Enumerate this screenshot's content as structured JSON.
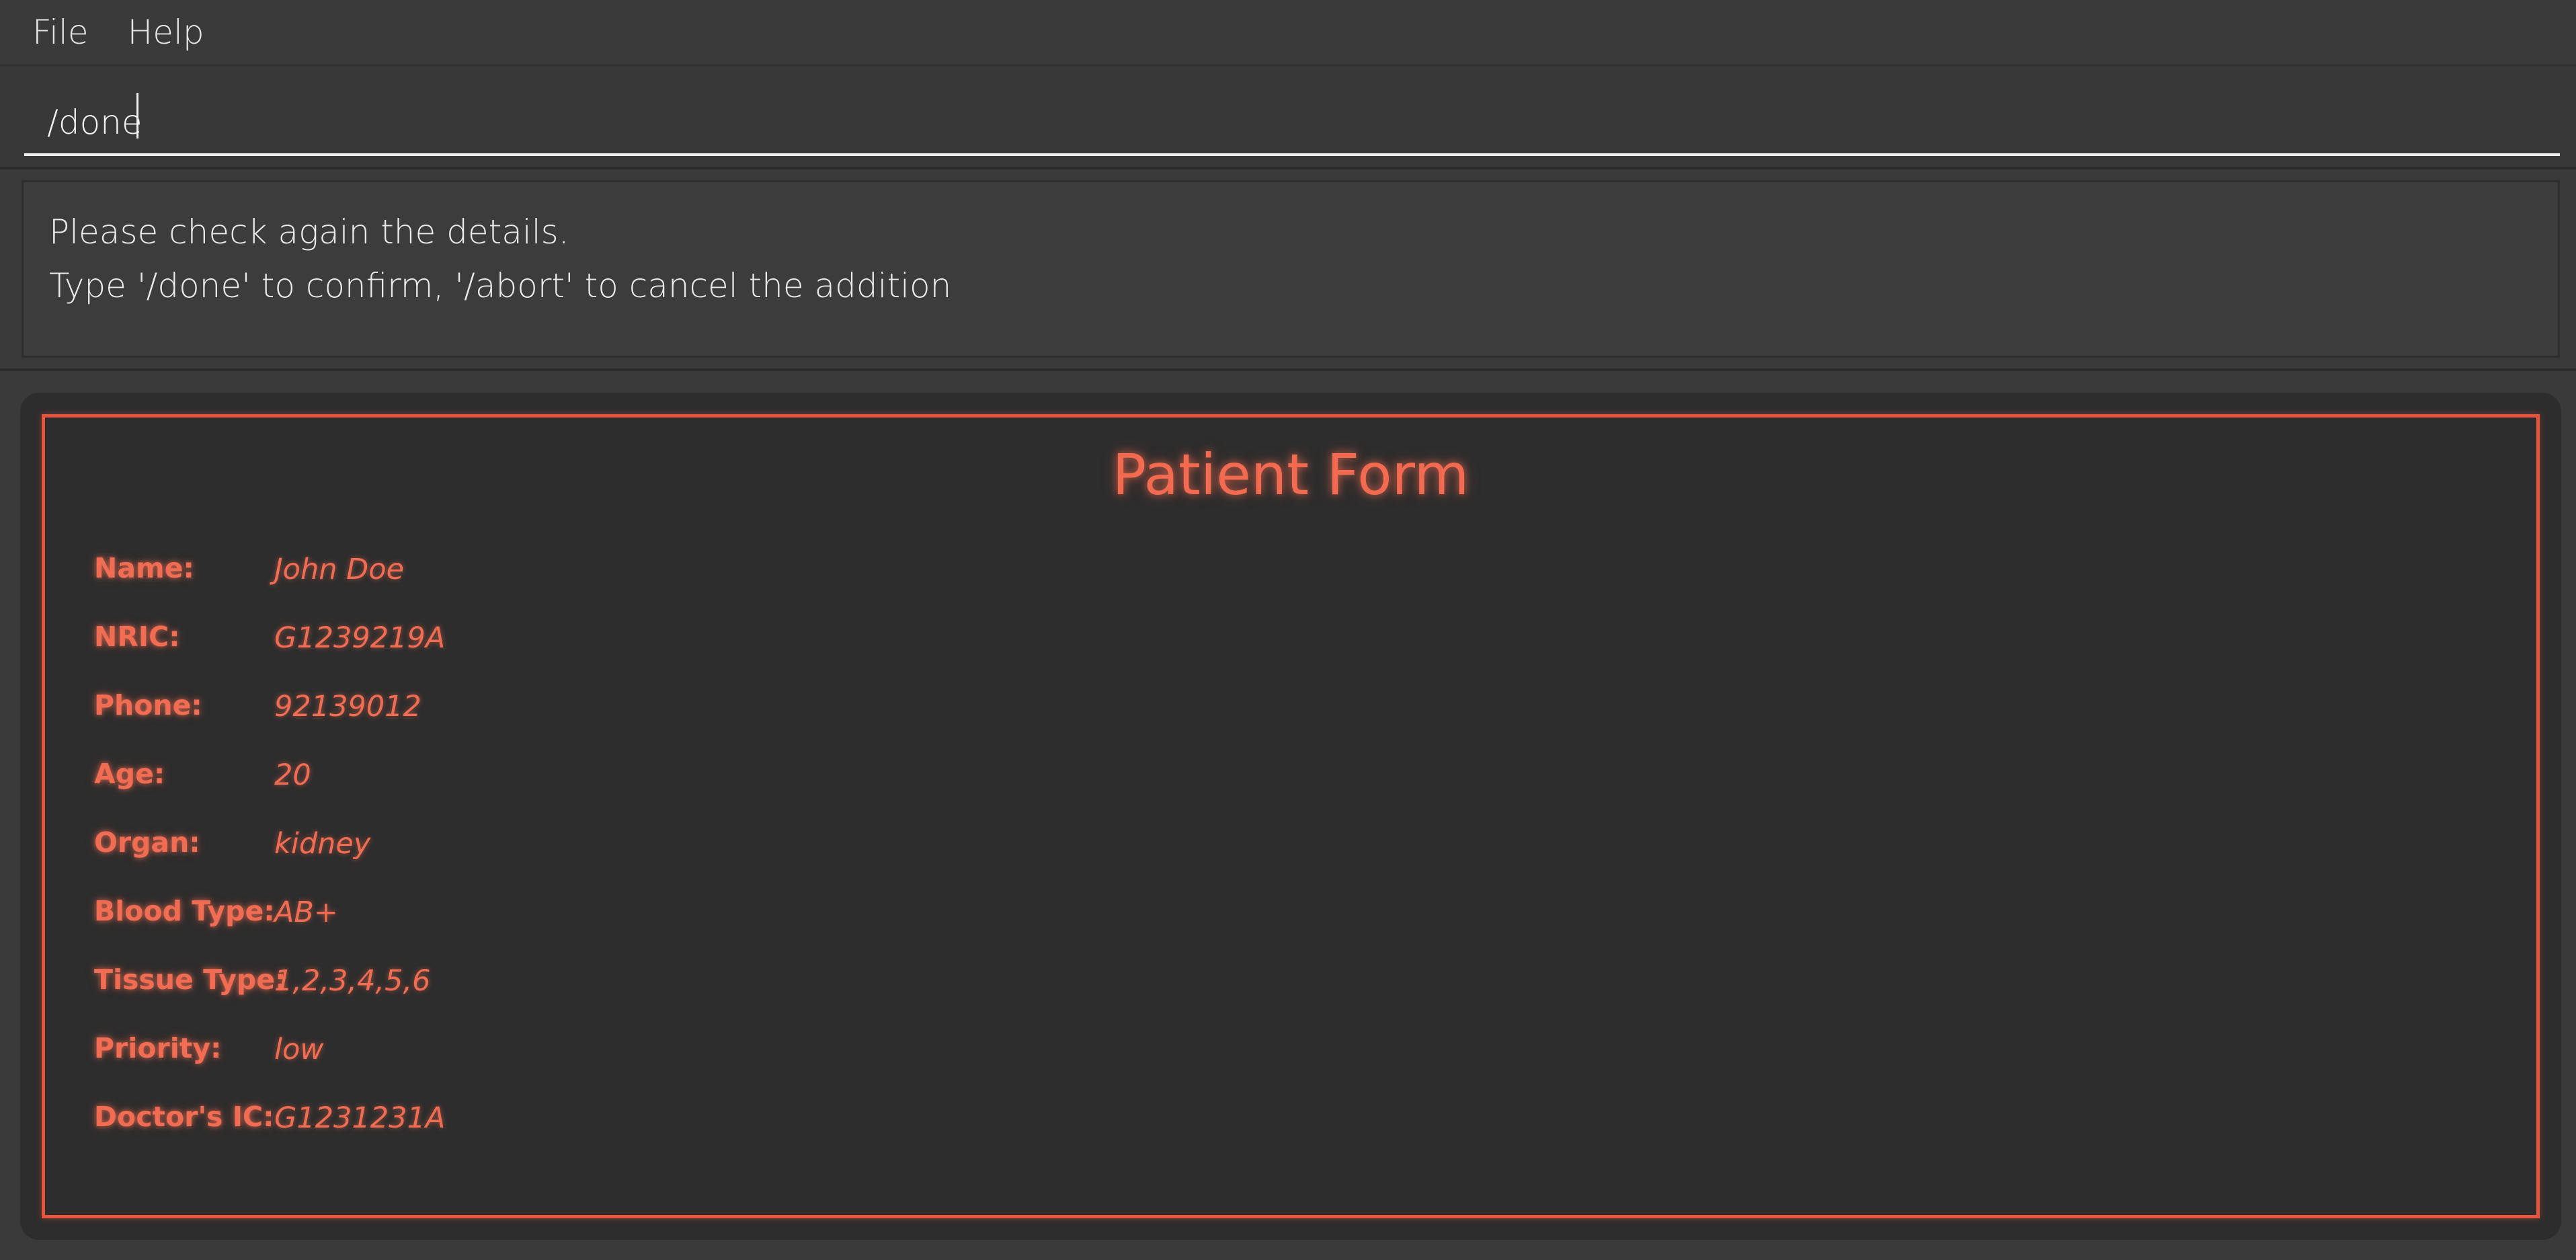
{
  "menu": {
    "file": "File",
    "help": "Help"
  },
  "command": {
    "value": "/done"
  },
  "result": {
    "line1": "Please check again the details.",
    "line2": "Type '/done' to confirm, '/abort' to cancel the addition"
  },
  "form": {
    "title": "Patient Form",
    "fields": [
      {
        "label": "Name:",
        "value": "John Doe"
      },
      {
        "label": "NRIC:",
        "value": "G1239219A"
      },
      {
        "label": "Phone:",
        "value": "92139012"
      },
      {
        "label": "Age:",
        "value": "20"
      },
      {
        "label": "Organ:",
        "value": "kidney"
      },
      {
        "label": "Blood Type:",
        "value": "AB+"
      },
      {
        "label": "Tissue Type:",
        "value": "1,2,3,4,5,6"
      },
      {
        "label": "Priority:",
        "value": "low"
      },
      {
        "label": "Doctor's IC:",
        "value": "G1231231A"
      }
    ]
  },
  "colors": {
    "accent": "#e8553f",
    "background": "#3a3a3a",
    "panel": "#2d2d2d"
  }
}
